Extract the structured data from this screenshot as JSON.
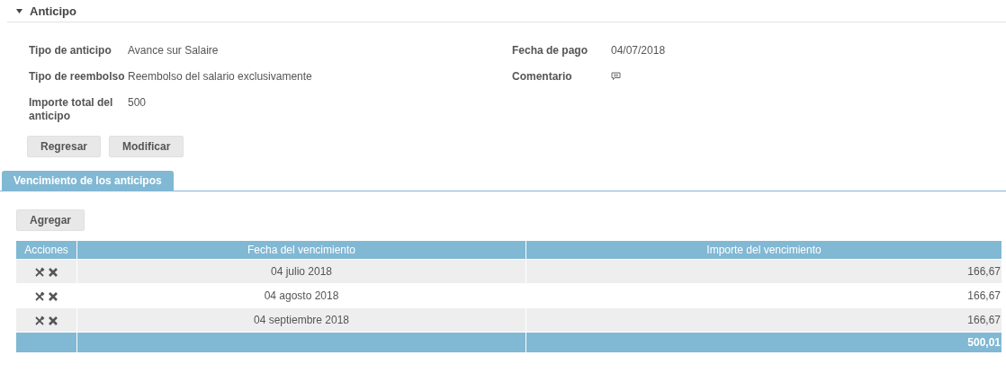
{
  "section": {
    "title": "Anticipo",
    "expanded": true
  },
  "fields_left": [
    {
      "label": "Tipo de anticipo",
      "value": "Avance sur Salaire"
    },
    {
      "label": "Tipo de reembolso",
      "value": "Reembolso del salario exclusivamente"
    },
    {
      "label": "Importe total del anticipo",
      "value": "500"
    }
  ],
  "fields_right": [
    {
      "label": "Fecha de pago",
      "kind": "text",
      "value": "04/07/2018"
    },
    {
      "label": "Comentario",
      "kind": "icon"
    }
  ],
  "buttons": [
    "Regresar",
    "Modificar"
  ],
  "tab": {
    "label": "Vencimiento de los anticipos",
    "selected": true
  },
  "add_button": "Agregar",
  "table": {
    "columns": [
      "Acciones",
      "Fecha del vencimiento",
      "Importe del vencimiento"
    ],
    "rows": [
      {
        "date": "04 julio 2018",
        "amount": "166,67"
      },
      {
        "date": "04 agosto 2018",
        "amount": "166,67"
      },
      {
        "date": "04 septiembre 2018",
        "amount": "166,67"
      }
    ],
    "total": "500,01"
  }
}
